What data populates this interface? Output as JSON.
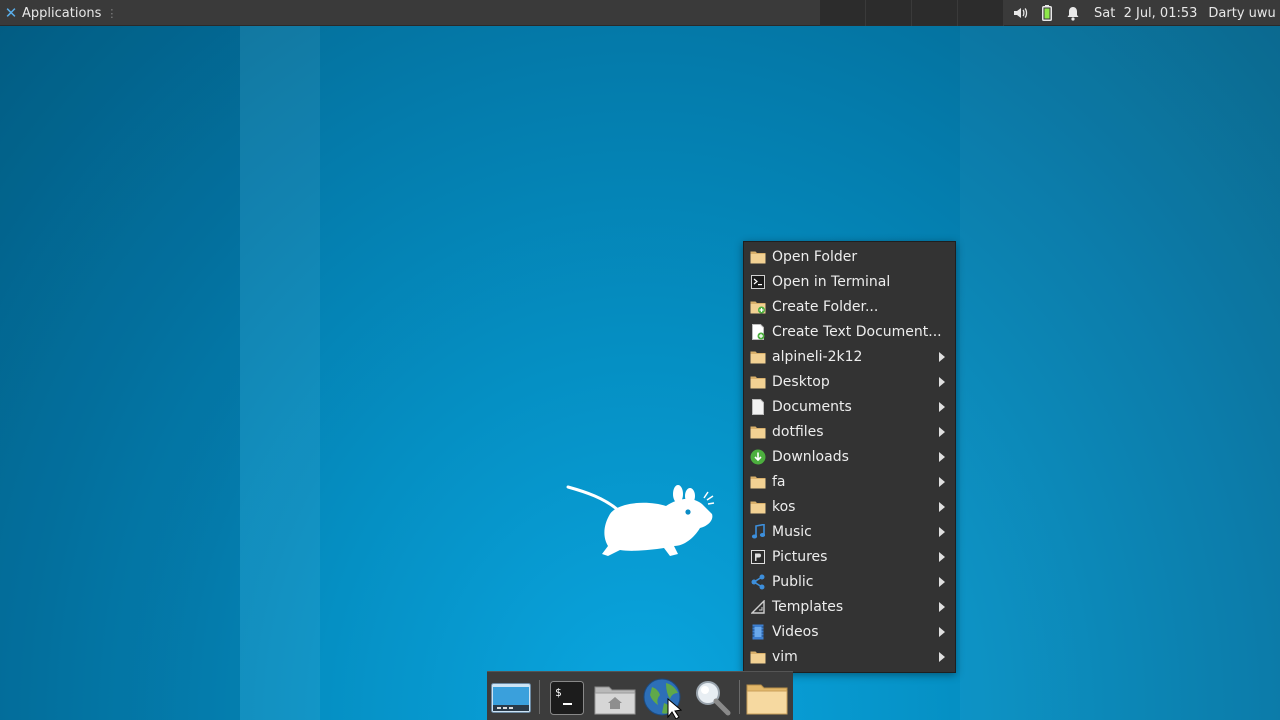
{
  "panel": {
    "applications_label": "Applications",
    "clock": "Sat  2 Jul, 01:53",
    "user": "Darty uwu",
    "tray_icons": [
      "volume-icon",
      "battery-icon",
      "notification-bell-icon"
    ]
  },
  "context_menu": {
    "items": [
      {
        "label": "Open Folder",
        "icon": "folder-icon",
        "submenu": false
      },
      {
        "label": "Open in Terminal",
        "icon": "terminal-icon",
        "submenu": false
      },
      {
        "label": "Create Folder...",
        "icon": "folder-new-icon",
        "submenu": false
      },
      {
        "label": "Create Text Document...",
        "icon": "document-new-icon",
        "submenu": false
      },
      {
        "label": "alpineli-2k12",
        "icon": "folder-icon",
        "submenu": true
      },
      {
        "label": "Desktop",
        "icon": "folder-icon",
        "submenu": true
      },
      {
        "label": "Documents",
        "icon": "document-icon",
        "submenu": true
      },
      {
        "label": "dotfiles",
        "icon": "folder-icon",
        "submenu": true
      },
      {
        "label": "Downloads",
        "icon": "download-icon",
        "submenu": true
      },
      {
        "label": "fa",
        "icon": "folder-icon",
        "submenu": true
      },
      {
        "label": "kos",
        "icon": "folder-icon",
        "submenu": true
      },
      {
        "label": "Music",
        "icon": "music-icon",
        "submenu": true
      },
      {
        "label": "Pictures",
        "icon": "pictures-icon",
        "submenu": true
      },
      {
        "label": "Public",
        "icon": "share-icon",
        "submenu": true
      },
      {
        "label": "Templates",
        "icon": "templates-icon",
        "submenu": true
      },
      {
        "label": "Videos",
        "icon": "video-icon",
        "submenu": true
      },
      {
        "label": "vim",
        "icon": "folder-icon",
        "submenu": true
      }
    ]
  },
  "dock": {
    "items": [
      "show-desktop-icon",
      "terminal-icon",
      "file-manager-icon",
      "web-browser-icon",
      "app-finder-icon",
      "folder-icon"
    ]
  },
  "colors": {
    "panel_bg": "#3a3a3a",
    "menu_bg": "#333333",
    "folder": "#f2d193",
    "accent_blue": "#3d8fdc",
    "download_green": "#4caf3e"
  }
}
